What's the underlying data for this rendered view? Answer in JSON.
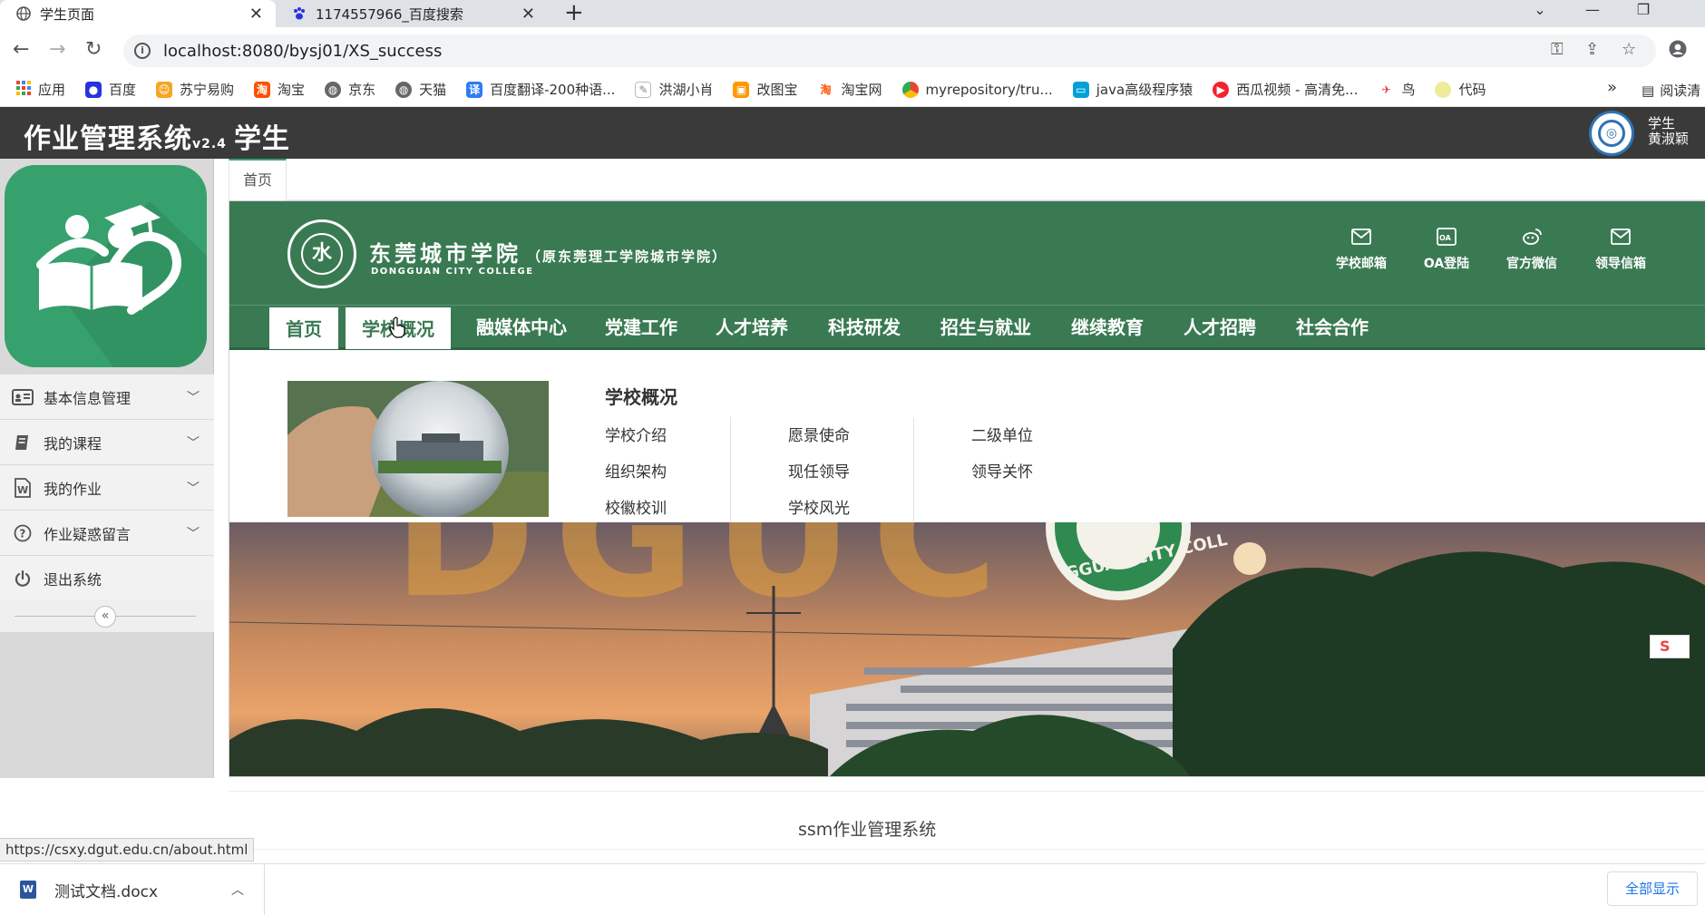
{
  "browser": {
    "tabs": [
      {
        "title": "学生页面"
      },
      {
        "title": "1174557966_百度搜索"
      }
    ],
    "url": "localhost:8080/bysj01/XS_success",
    "bookmarks": [
      {
        "label": "应用",
        "icon": "apps-grid-icon",
        "color": "#4285f4"
      },
      {
        "label": "百度",
        "icon": "baidu-paw-icon",
        "color": "#2932e1"
      },
      {
        "label": "苏宁易购",
        "icon": "suning-lion-icon",
        "color": "#f5a623"
      },
      {
        "label": "淘宝",
        "icon": "taobao-icon",
        "color": "#ff5000"
      },
      {
        "label": "京东",
        "icon": "globe-icon",
        "color": "#666666"
      },
      {
        "label": "天猫",
        "icon": "globe-icon",
        "color": "#666666"
      },
      {
        "label": "百度翻译-200种语...",
        "icon": "translate-icon",
        "color": "#2b7cf6"
      },
      {
        "label": "洪湖小肖",
        "icon": "bird-icon",
        "color": "#888888"
      },
      {
        "label": "改图宝",
        "icon": "image-edit-icon",
        "color": "#ff9900"
      },
      {
        "label": "淘宝网",
        "icon": "taobao-icon",
        "color": "#ff5000"
      },
      {
        "label": "myrepository/tru...",
        "icon": "chrome-icon",
        "color": "#34a853"
      },
      {
        "label": "java高级程序猿",
        "icon": "bilibili-tv-icon",
        "color": "#00a1d6"
      },
      {
        "label": "西瓜视频 - 高清免...",
        "icon": "xigua-video-icon",
        "color": "#f4212e"
      },
      {
        "label": "鸟",
        "icon": "bird-icon",
        "color": "#e53935"
      },
      {
        "label": "代码",
        "icon": "folder-icon",
        "color": "#d6d68a"
      }
    ],
    "bookmarks_more": "»",
    "reader_mode": "阅读清",
    "status_url": "https://csxy.dgut.edu.cn/about.html"
  },
  "app": {
    "title": "作业管理系统",
    "version": "v2.4",
    "role": "学生",
    "user_role": "学生",
    "user_name": "黄淑颖"
  },
  "sidebar": {
    "items": [
      {
        "label": "基本信息管理",
        "icon": "id-card-icon"
      },
      {
        "label": "我的课程",
        "icon": "book-icon"
      },
      {
        "label": "我的作业",
        "icon": "word-document-icon"
      },
      {
        "label": "作业疑惑留言",
        "icon": "question-circle-icon"
      },
      {
        "label": "退出系统",
        "icon": "power-icon"
      }
    ],
    "collapse_glyph": "«"
  },
  "content": {
    "home_tab": "首页",
    "school": {
      "name_cn": "东莞城市学院",
      "name_en": "DONGGUAN CITY COLLEGE",
      "former_name": "（原东莞理工学院城市学院）",
      "logo_glyph": "水",
      "quick_links": [
        {
          "label": "学校邮箱",
          "icon": "mail-icon"
        },
        {
          "label": "OA登陆",
          "icon": "oa-icon"
        },
        {
          "label": "官方微信",
          "icon": "wechat-icon"
        },
        {
          "label": "领导信箱",
          "icon": "mail-icon"
        }
      ],
      "nav": [
        "首页",
        "学校概况",
        "融媒体中心",
        "党建工作",
        "人才培养",
        "科技研发",
        "招生与就业",
        "继续教育",
        "人才招聘",
        "社会合作"
      ],
      "dropdown": {
        "title": "学校概况",
        "col1": [
          "学校介绍",
          "组织架构",
          "校徽校训"
        ],
        "col2": [
          "愿景使命",
          "现任领导",
          "学校风光"
        ],
        "col3": [
          "二级单位",
          "领导关怀"
        ]
      },
      "banner_seal_text": "GGUAN CITY COLL",
      "banner_letters": "DGUC"
    },
    "footer": "ssm作业管理系统"
  },
  "downloads": {
    "file_name": "测试文档.docx",
    "show_all": "全部显示"
  },
  "colors": {
    "school_green": "#3a7a53",
    "app_header": "#3a3a3a",
    "logo_green": "#37a16d"
  }
}
